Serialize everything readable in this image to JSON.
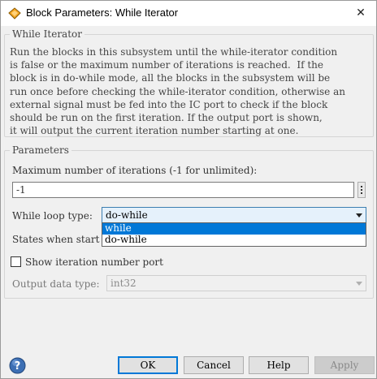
{
  "window": {
    "title": "Block Parameters: While Iterator",
    "close_glyph": "✕"
  },
  "description": {
    "group_title": "While Iterator",
    "text": "Run the blocks in this subsystem until the while-iterator condition\nis false or the maximum number of iterations is reached.  If the\nblock is in do-while mode, all the blocks in the subsystem will be\nrun once before checking the while-iterator condition, otherwise an\nexternal signal must be fed into the IC port to check if the block\nshould be run on the first iteration. If the output port is shown,\nit will output the current iteration number starting at one."
  },
  "parameters": {
    "group_title": "Parameters",
    "max_iter_label": "Maximum number of iterations (-1 for unlimited):",
    "max_iter_value": "-1",
    "loop_type_label": "While loop type:",
    "loop_type_value": "do-while",
    "loop_type_options": [
      "while",
      "do-while"
    ],
    "highlighted_option": "while",
    "states_label": "States when start",
    "show_port_label": "Show iteration number port",
    "show_port_checked": false,
    "output_type_label": "Output data type:",
    "output_type_value": "int32"
  },
  "buttons": {
    "ok": "OK",
    "cancel": "Cancel",
    "help": "Help",
    "apply": "Apply"
  },
  "colors": {
    "accent": "#0078d7",
    "help_icon": "#3d6fb4"
  },
  "icons": {
    "app": "simulink-block-icon",
    "help": "help-question-icon"
  }
}
